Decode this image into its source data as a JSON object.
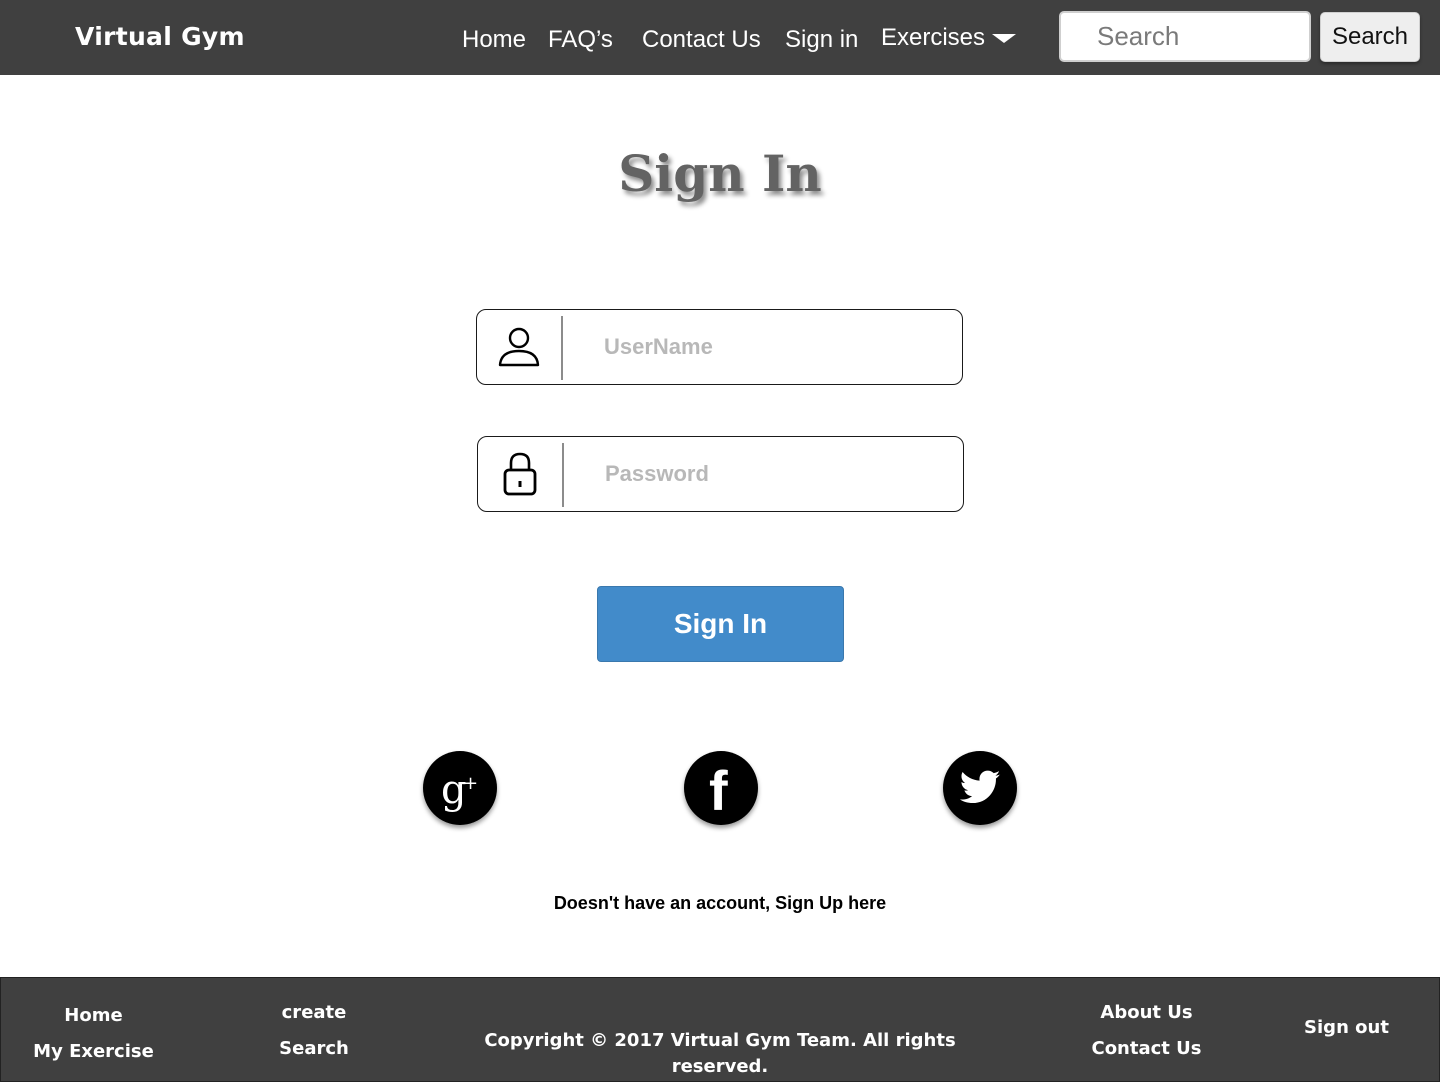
{
  "header": {
    "brand": "Virtual Gym",
    "nav": {
      "home": "Home",
      "faqs": "FAQ’s",
      "contact": "Contact Us",
      "signin": "Sign in",
      "exercises": "Exercises"
    },
    "search_placeholder": "Search",
    "search_button": "Search",
    "bar_color": "#404040"
  },
  "main": {
    "title": "Sign In",
    "username_placeholder": "UserName",
    "password_placeholder": "Password",
    "signin_button": "Sign In",
    "signin_button_color": "#428bca",
    "social": {
      "icons": [
        "google-plus-icon",
        "facebook-icon",
        "twitter-icon"
      ]
    },
    "signup_text": "Doesn't have an account, Sign Up here"
  },
  "footer": {
    "col1": [
      "Home",
      "My Exercise"
    ],
    "col2": [
      "create",
      "Search"
    ],
    "copyright": "Copyright © 2017 Virtual Gym Team. All rights reserved.",
    "col4": [
      "About Us",
      "Contact Us"
    ],
    "col5": [
      "Sign out"
    ]
  }
}
